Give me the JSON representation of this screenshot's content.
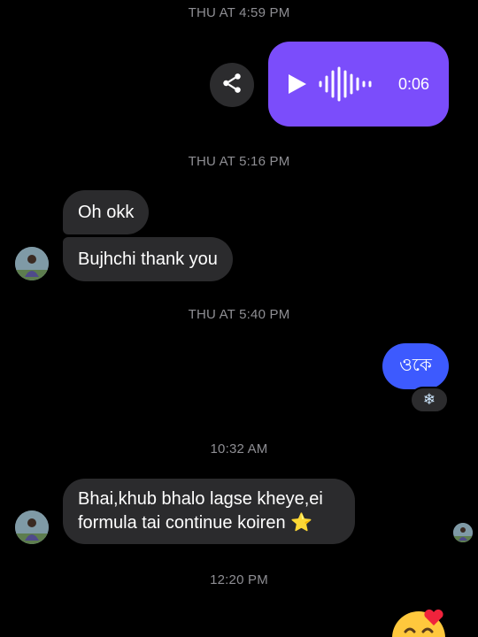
{
  "thread": {
    "timestamps": [
      "THU AT 4:59 PM",
      "THU AT 5:16 PM",
      "THU AT 5:40 PM",
      "10:32 AM",
      "12:20 PM"
    ]
  },
  "voice_message": {
    "duration": "0:06",
    "accent_color": "#7b4dfb",
    "play_icon": "play-icon",
    "waveform_icon": "waveform-icon"
  },
  "share_button": {
    "icon": "share-icon"
  },
  "messages": {
    "incoming_1": "Oh okk",
    "incoming_2": "Bujhchi thank you",
    "outgoing_1": "ওকে",
    "outgoing_1_reaction": "❄",
    "incoming_3_line1": "Bhai,khub bhalo lagse kheye,ei",
    "incoming_3_line2": "formula tai continue koiren",
    "incoming_3_emoji": "⭐",
    "last_reaction_emoji": "smiling-face-with-hearts"
  },
  "colors": {
    "outgoing_bubble": "#3d5afe",
    "incoming_bubble": "#2b2b2d",
    "timestamp_text": "#8e8e93",
    "background": "#000000"
  }
}
